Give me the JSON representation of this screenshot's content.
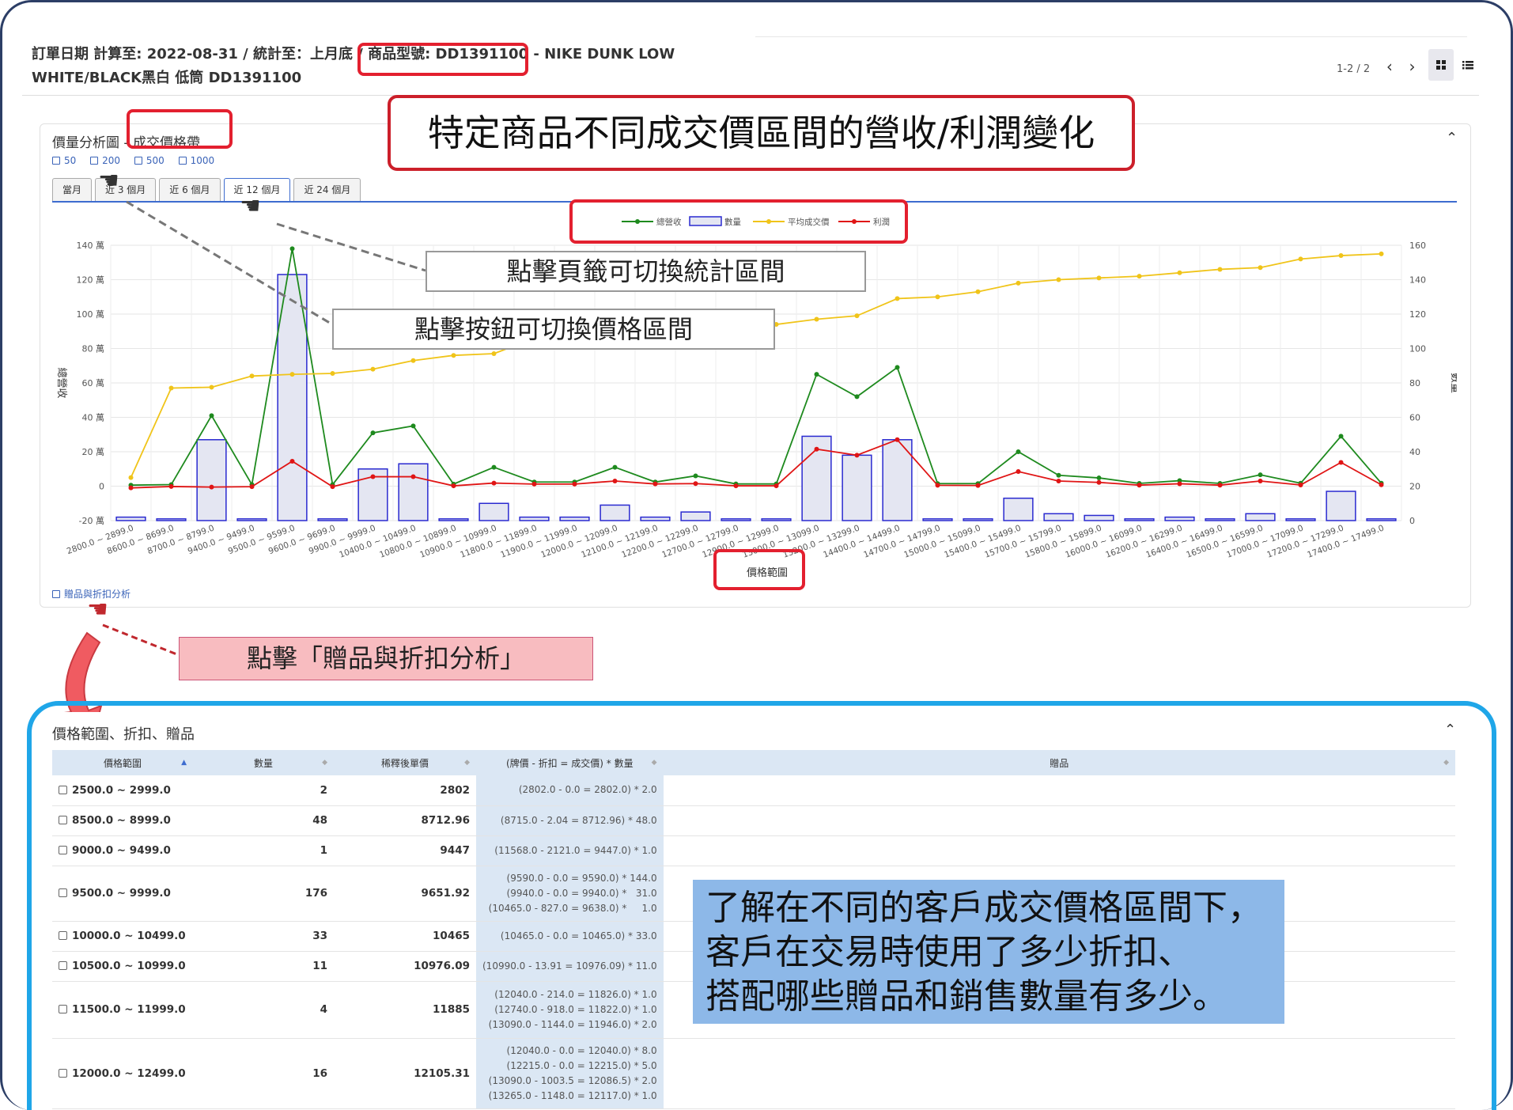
{
  "header": {
    "title_line1": "訂單日期 計算至: 2022-08-31 / 統計至：上月底 / 商品型號: DD1391100 - NIKE DUNK LOW",
    "title_line2": "WHITE/BLACK黑白 低筒 DD1391100",
    "pager": "1-2 / 2",
    "prev": "‹",
    "next": "›"
  },
  "panel": {
    "title": "價量分析圖 - 成交價格帶",
    "collapse": "⌃",
    "buckets": [
      "50",
      "200",
      "500",
      "1000"
    ],
    "tabs": [
      "當月",
      "近 3 個月",
      "近 6 個月",
      "近 12 個月",
      "近 24 個月"
    ],
    "active_tab": 3,
    "gift_link": "贈品與折扣分析"
  },
  "annotations": {
    "headline": "特定商品不同成交價區間的營收/利潤變化",
    "tabs_hint": "點擊頁籤可切換統計區間",
    "buttons_hint": "點擊按鈕可切換價格區間",
    "gift_hint": "點擊「贈品與折扣分析」",
    "note_line1": "了解在不同的客戶成交價格區間下，",
    "note_line2": "客戶在交易時使用了多少折扣、",
    "note_line3": "搭配哪些贈品和銷售數量有多少。"
  },
  "colors": {
    "revenue": "#1e8a1e",
    "quantity": "#2a2ad0",
    "avg_price": "#f0c419",
    "profit": "#e01515",
    "accent": "#3d6ccf",
    "highlight": "#e3202f",
    "panel_border": "#1fa6e8"
  },
  "chart_data": {
    "type": "line",
    "xlabel": "價格範圍",
    "ylabel_left": "總營收",
    "ylabel_right": "數量",
    "yleft_ticks": [
      "140 萬",
      "120 萬",
      "100 萬",
      "80 萬",
      "60 萬",
      "40 萬",
      "20 萬",
      "0",
      "-20 萬"
    ],
    "yright_ticks": [
      "160",
      "140",
      "120",
      "100",
      "80",
      "60",
      "40",
      "20",
      "0"
    ],
    "ylim_left": [
      -20,
      140
    ],
    "ylim_right": [
      0,
      160
    ],
    "legend": [
      "總營收",
      "數量",
      "平均成交價",
      "利潤"
    ],
    "legend_position": "top-center",
    "grid": true,
    "categories": [
      "2800.0 ~ 2899.0",
      "8600.0 ~ 8699.0",
      "8700.0 ~ 8799.0",
      "9400.0 ~ 9499.0",
      "9500.0 ~ 9599.0",
      "9600.0 ~ 9699.0",
      "9900.0 ~ 9999.0",
      "10400.0 ~ 10499.0",
      "10800.0 ~ 10899.0",
      "10900.0 ~ 10999.0",
      "11800.0 ~ 11899.0",
      "11900.0 ~ 11999.0",
      "12000.0 ~ 12099.0",
      "12100.0 ~ 12199.0",
      "12200.0 ~ 12299.0",
      "12700.0 ~ 12799.0",
      "12900.0 ~ 12999.0",
      "13000.0 ~ 13099.0",
      "13200.0 ~ 13299.0",
      "14400.0 ~ 14499.0",
      "14700.0 ~ 14799.0",
      "15000.0 ~ 15099.0",
      "15400.0 ~ 15499.0",
      "15700.0 ~ 15799.0",
      "15800.0 ~ 15899.0",
      "16000.0 ~ 16099.0",
      "16200.0 ~ 16299.0",
      "16400.0 ~ 16499.0",
      "16500.0 ~ 16599.0",
      "17000.0 ~ 17099.0",
      "17200.0 ~ 17299.0",
      "17400.0 ~ 17499.0"
    ],
    "series": [
      {
        "name": "總營收",
        "axis": "left",
        "values": [
          0.6,
          0.9,
          41,
          0.9,
          138,
          0.9,
          31,
          35,
          1.2,
          11,
          2.4,
          2.4,
          11,
          2.4,
          6,
          1.3,
          1.3,
          65,
          52,
          69,
          1.5,
          1.5,
          20,
          6.3,
          4.8,
          1.6,
          3.2,
          1.6,
          6.6,
          1.7,
          29,
          1.7
        ]
      },
      {
        "name": "數量",
        "axis": "right",
        "values": [
          2,
          1,
          47,
          1,
          143,
          1,
          30,
          33,
          1,
          10,
          2,
          2,
          9,
          2,
          5,
          1,
          1,
          49,
          38,
          47,
          1,
          1,
          13,
          4,
          3,
          1,
          2,
          1,
          4,
          1,
          17,
          1
        ]
      },
      {
        "name": "平均成交價",
        "axis": "left",
        "values": [
          5,
          57,
          57.5,
          64,
          65,
          65.5,
          68,
          73,
          76,
          77,
          86,
          88,
          90,
          91,
          91.5,
          93,
          94,
          97,
          99,
          109,
          110,
          113,
          118,
          120,
          121,
          122,
          124,
          126,
          127,
          132,
          134,
          135
        ]
      },
      {
        "name": "利潤",
        "axis": "left",
        "values": [
          -1,
          -0.2,
          -0.5,
          -0.3,
          14.5,
          -0.3,
          5.5,
          5.5,
          0.2,
          1.8,
          1.2,
          1.2,
          3,
          1.3,
          1.5,
          0.2,
          0.2,
          21.5,
          18,
          27,
          0.5,
          0.4,
          8.5,
          3,
          2.2,
          0.6,
          1.4,
          0.6,
          3,
          0.7,
          13.8,
          0.8
        ]
      }
    ]
  },
  "bottom": {
    "title": "價格範圍、折扣、贈品",
    "collapse": "⌃",
    "columns": [
      "價格範圍",
      "數量",
      "稀釋後單價",
      "(牌價 - 折扣 = 成交價) * 數量",
      "贈品"
    ],
    "rows": [
      {
        "range": "2500.0 ~ 2999.0",
        "qty": "2",
        "unit": "2802",
        "formula": [
          "(2802.0 - 0.0 = 2802.0) * 2.0"
        ],
        "gift": ""
      },
      {
        "range": "8500.0 ~ 8999.0",
        "qty": "48",
        "unit": "8712.96",
        "formula": [
          "(8715.0 - 2.04 = 8712.96) * 48.0"
        ],
        "gift": ""
      },
      {
        "range": "9000.0 ~ 9499.0",
        "qty": "1",
        "unit": "9447",
        "formula": [
          "(11568.0 - 2121.0 = 9447.0) * 1.0"
        ],
        "gift": ""
      },
      {
        "range": "9500.0 ~ 9999.0",
        "qty": "176",
        "unit": "9651.92",
        "formula": [
          "(9590.0 - 0.0 = 9590.0) * 144.0",
          "(9940.0 - 0.0 = 9940.0) *   31.0",
          "(10465.0 - 827.0 = 9638.0) *     1.0"
        ],
        "gift": ""
      },
      {
        "range": "10000.0 ~ 10499.0",
        "qty": "33",
        "unit": "10465",
        "formula": [
          "(10465.0 - 0.0 = 10465.0) * 33.0"
        ],
        "gift": ""
      },
      {
        "range": "10500.0 ~ 10999.0",
        "qty": "11",
        "unit": "10976.09",
        "formula": [
          "(10990.0 - 13.91 = 10976.09) * 11.0"
        ],
        "gift": ""
      },
      {
        "range": "11500.0 ~ 11999.0",
        "qty": "4",
        "unit": "11885",
        "formula": [
          "(12040.0 - 214.0 = 11826.0) * 1.0",
          "(12740.0 - 918.0 = 11822.0) * 1.0",
          "(13090.0 - 1144.0 = 11946.0) * 2.0"
        ],
        "gift": ""
      },
      {
        "range": "12000.0 ~ 12499.0",
        "qty": "16",
        "unit": "12105.31",
        "formula": [
          "(12040.0 - 0.0 = 12040.0) * 8.0",
          "(12215.0 - 0.0 = 12215.0) * 5.0",
          "(13090.0 - 1003.5 = 12086.5) * 2.0",
          "(13265.0 - 1148.0 = 12117.0) * 1.0"
        ],
        "gift": ""
      }
    ]
  }
}
